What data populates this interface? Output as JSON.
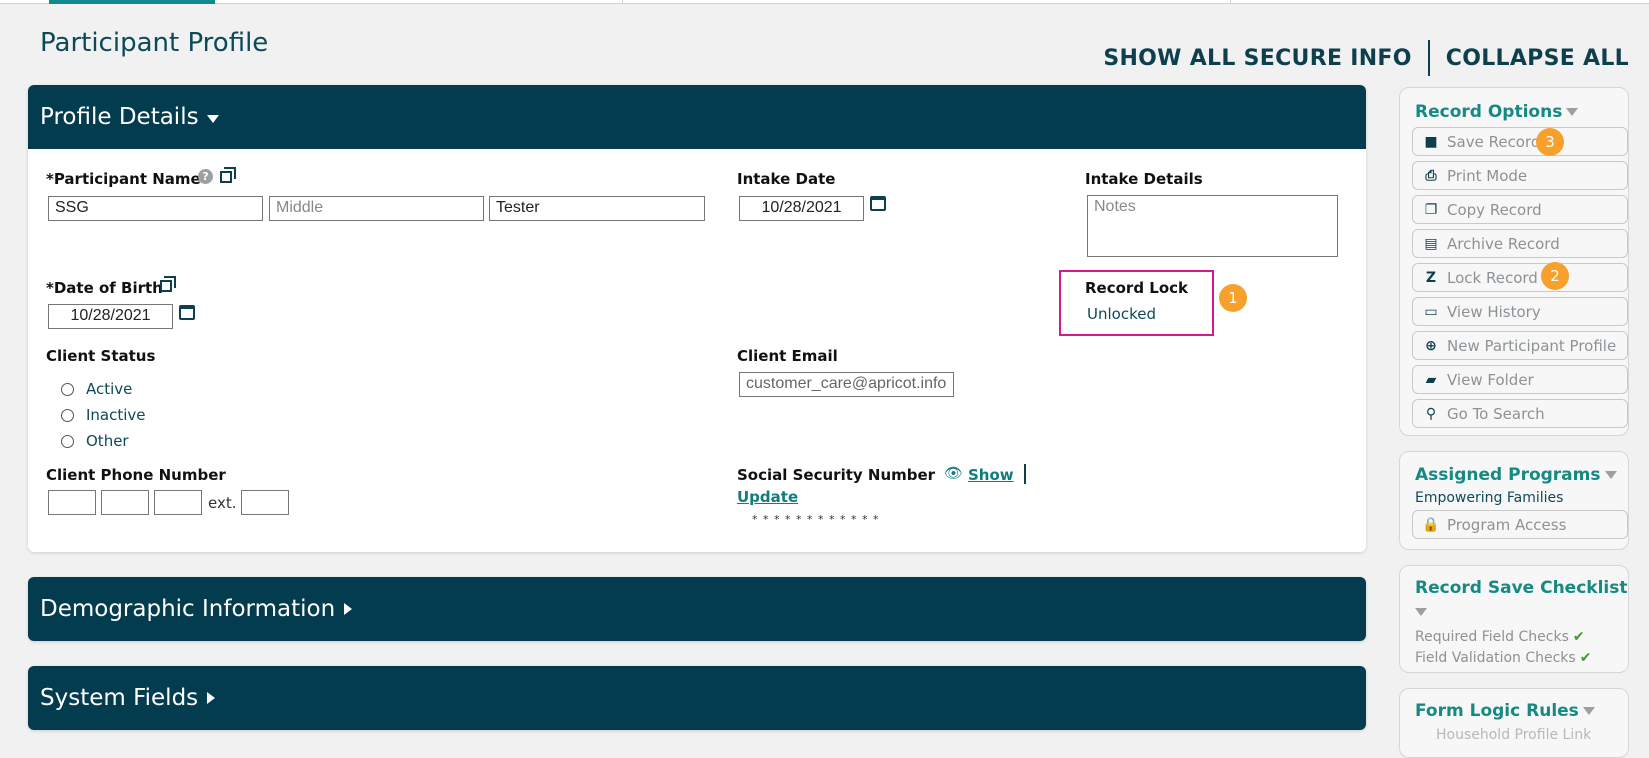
{
  "header": {
    "page_title": "Participant Profile",
    "show_all_secure_info": "SHOW ALL SECURE INFO",
    "collapse_all": "COLLAPSE ALL"
  },
  "profile_details": {
    "title": "Profile Details",
    "participant_name": {
      "label": "*Participant Name",
      "first": "SSG",
      "middle_placeholder": "Middle",
      "last": "Tester"
    },
    "intake_date": {
      "label": "Intake Date",
      "value": "10/28/2021"
    },
    "intake_details": {
      "label": "Intake Details",
      "placeholder": "Notes"
    },
    "date_of_birth": {
      "label": "*Date of Birth",
      "value": "10/28/2021"
    },
    "record_lock": {
      "label": "Record Lock",
      "value": "Unlocked"
    },
    "client_status": {
      "label": "Client Status",
      "options": [
        "Active",
        "Inactive",
        "Other"
      ]
    },
    "client_email": {
      "label": "Client Email",
      "value": "customer_care@apricot.info"
    },
    "client_phone": {
      "label": "Client Phone Number",
      "ext_label": "ext."
    },
    "ssn": {
      "label": "Social Security Number",
      "show": "Show",
      "update": "Update",
      "masked": "* * * * * * * * * * * *"
    }
  },
  "demographic": {
    "title": "Demographic Information"
  },
  "system_fields": {
    "title": "System Fields"
  },
  "sidebar": {
    "record_options": {
      "title": "Record Options",
      "buttons": [
        "Save Record",
        "Print Mode",
        "Copy Record",
        "Archive Record",
        "Lock Record",
        "View History",
        "New Participant Profile",
        "View Folder",
        "Go To Search"
      ]
    },
    "assigned_programs": {
      "title": "Assigned Programs",
      "program": "Empowering Families",
      "button": "Program Access"
    },
    "checklist": {
      "title": "Record Save Checklist",
      "items": [
        "Required Field Checks",
        "Field Validation Checks"
      ]
    },
    "form_logic": {
      "title": "Form Logic Rules",
      "item": "Household Profile Link"
    }
  },
  "badges": [
    "1",
    "2",
    "3"
  ],
  "colors": {
    "header_bg": "#023c4e",
    "accent_teal": "#168a82",
    "badge_orange": "#f7a02b",
    "highlight_magenta": "#d41a8c"
  }
}
